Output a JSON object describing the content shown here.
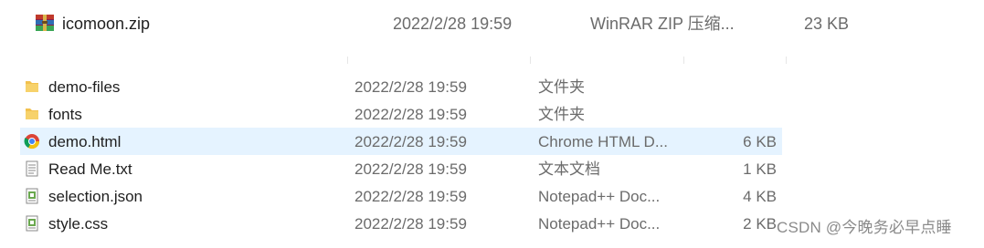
{
  "zip_row": {
    "name": "icomoon.zip",
    "date": "2022/2/28 19:59",
    "type": "WinRAR ZIP 压缩...",
    "size": "23 KB",
    "icon": "winrar-archive-icon"
  },
  "files": [
    {
      "name": "demo-files",
      "date": "2022/2/28 19:59",
      "type": "文件夹",
      "size": "",
      "icon": "folder-icon",
      "selected": false
    },
    {
      "name": "fonts",
      "date": "2022/2/28 19:59",
      "type": "文件夹",
      "size": "",
      "icon": "folder-icon",
      "selected": false
    },
    {
      "name": "demo.html",
      "date": "2022/2/28 19:59",
      "type": "Chrome HTML D...",
      "size": "6 KB",
      "icon": "chrome-icon",
      "selected": true
    },
    {
      "name": "Read Me.txt",
      "date": "2022/2/28 19:59",
      "type": "文本文档",
      "size": "1 KB",
      "icon": "text-file-icon",
      "selected": false
    },
    {
      "name": "selection.json",
      "date": "2022/2/28 19:59",
      "type": "Notepad++ Doc...",
      "size": "4 KB",
      "icon": "notepadpp-file-icon",
      "selected": false
    },
    {
      "name": "style.css",
      "date": "2022/2/28 19:59",
      "type": "Notepad++ Doc...",
      "size": "2 KB",
      "icon": "notepadpp-file-icon",
      "selected": false
    }
  ],
  "watermark": "CSDN @今晚务必早点睡",
  "colors": {
    "selection": "#e5f3ff",
    "folder": "#f2c14e"
  }
}
